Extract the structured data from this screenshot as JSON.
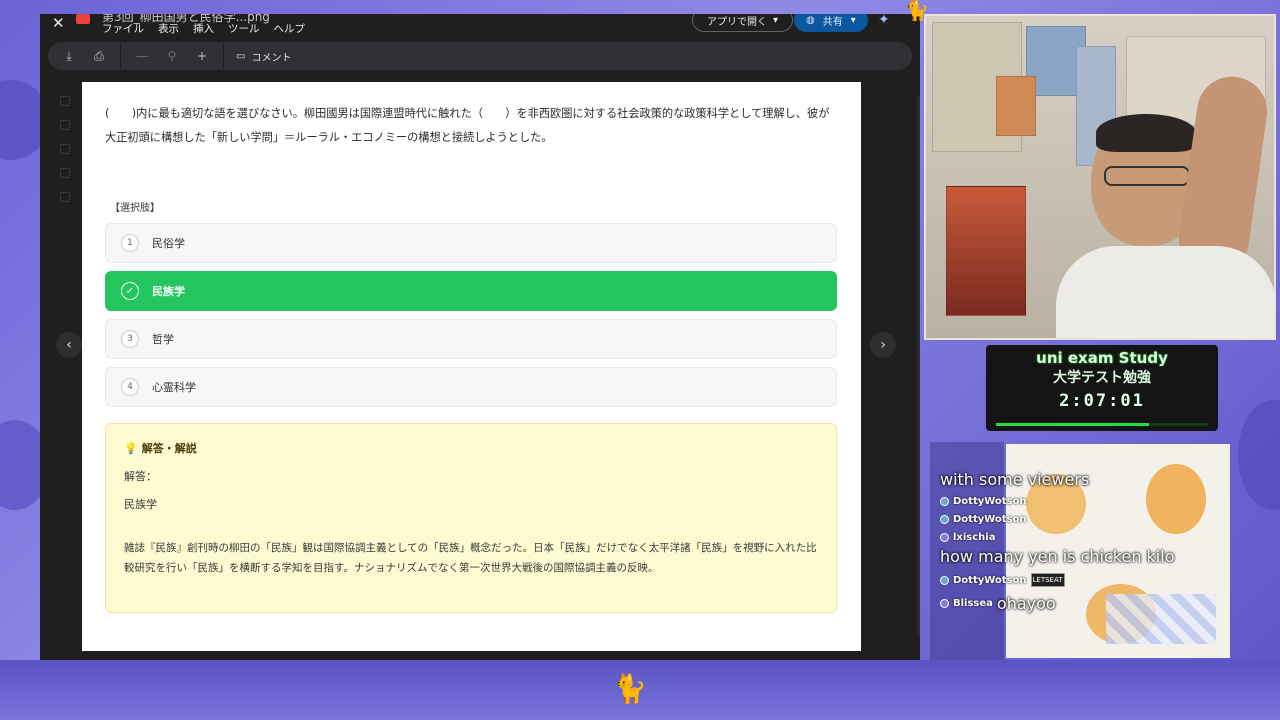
{
  "drive": {
    "file_name": "第3回_柳田国男と民俗学...png",
    "menu": [
      "ファイル",
      "表示",
      "挿入",
      "ツール",
      "ヘルプ"
    ],
    "open_with_label": "アプリで開く",
    "share_label": "共有",
    "comment_label": "コメント"
  },
  "quiz": {
    "question": "(　　)内に最も適切な語を選びなさい。柳田國男は国際連盟時代に触れた（　　）を非西欧圏に対する社会政策的な政策科学として理解し、彼が大正初頭に構想した「新しい学問」＝ルーラル・エコノミーの構想と接続しようとした。",
    "choices_heading": "【選択肢】",
    "choices": [
      {
        "num": "1",
        "label": "民俗学",
        "correct": false
      },
      {
        "num": "✓",
        "label": "民族学",
        "correct": true
      },
      {
        "num": "3",
        "label": "哲学",
        "correct": false
      },
      {
        "num": "4",
        "label": "心霊科学",
        "correct": false
      }
    ],
    "answer_title": "解答・解説",
    "answer_label": "解答：",
    "answer_value": "民族学",
    "explanation": "雑誌『民族』創刊時の柳田の「民族」観は国際協調主義としての「民族」概念だった。日本「民族」だけでなく太平洋諸「民族」を視野に入れた比較研究を行い「民族」を横断する学知を目指す。ナショナリズムでなく第一次世界大戦後の国際協調主義の反映。"
  },
  "stream": {
    "title_en": "uni exam Study",
    "title_jp": "大学テスト勉強",
    "timer": "2:07:01",
    "timer_progress": 0.72
  },
  "chat": [
    {
      "user": "",
      "message": "with some viewers"
    },
    {
      "user": "DottyWotson",
      "message": ""
    },
    {
      "user": "DottyWotson",
      "message": ""
    },
    {
      "user": "lxischia",
      "message": "how many yen is chicken kilo"
    },
    {
      "user": "DottyWotson",
      "message": "",
      "emote": "LETSEAT"
    },
    {
      "user": "Blissea",
      "message": "ohayoo"
    }
  ],
  "colors": {
    "correct": "#22c55e",
    "answer_bg": "#fefbd2",
    "share": "#0b57a0",
    "background": "#6b63d6"
  }
}
